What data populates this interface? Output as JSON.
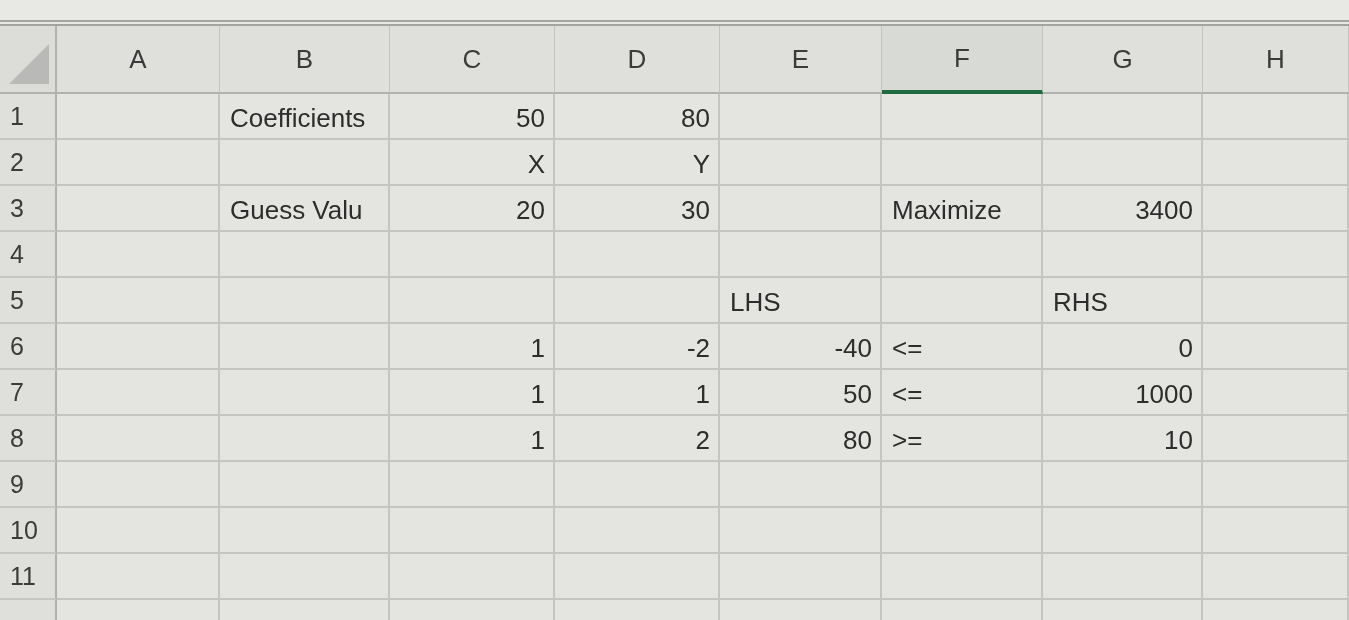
{
  "columns": [
    {
      "label": "A",
      "selected": false
    },
    {
      "label": "B",
      "selected": false
    },
    {
      "label": "C",
      "selected": false
    },
    {
      "label": "D",
      "selected": false
    },
    {
      "label": "E",
      "selected": false
    },
    {
      "label": "F",
      "selected": true
    },
    {
      "label": "G",
      "selected": false
    },
    {
      "label": "H",
      "selected": false
    }
  ],
  "rows": [
    {
      "label": "1",
      "cells": {
        "B": {
          "text": "Coefficients",
          "kind": "text"
        },
        "C": {
          "text": "50",
          "kind": "value"
        },
        "D": {
          "text": "80",
          "kind": "value"
        }
      }
    },
    {
      "label": "2",
      "cells": {
        "C": {
          "text": "X",
          "kind": "value"
        },
        "D": {
          "text": "Y",
          "kind": "value"
        }
      }
    },
    {
      "label": "3",
      "cells": {
        "B": {
          "text": "Guess Valu",
          "kind": "text"
        },
        "C": {
          "text": "20",
          "kind": "value"
        },
        "D": {
          "text": "30",
          "kind": "value"
        },
        "F": {
          "text": "Maximize",
          "kind": "text"
        },
        "G": {
          "text": "3400",
          "kind": "value"
        }
      }
    },
    {
      "label": "4"
    },
    {
      "label": "5",
      "cells": {
        "E": {
          "text": "LHS",
          "kind": "text"
        },
        "G": {
          "text": "RHS",
          "kind": "text"
        }
      }
    },
    {
      "label": "6",
      "cells": {
        "C": {
          "text": "1",
          "kind": "value"
        },
        "D": {
          "text": "-2",
          "kind": "value"
        },
        "E": {
          "text": "-40",
          "kind": "value"
        },
        "F": {
          "text": "<=",
          "kind": "text"
        },
        "G": {
          "text": "0",
          "kind": "value"
        }
      }
    },
    {
      "label": "7",
      "cells": {
        "C": {
          "text": "1",
          "kind": "value"
        },
        "D": {
          "text": "1",
          "kind": "value"
        },
        "E": {
          "text": "50",
          "kind": "value"
        },
        "F": {
          "text": "<=",
          "kind": "text"
        },
        "G": {
          "text": "1000",
          "kind": "value"
        }
      }
    },
    {
      "label": "8",
      "cells": {
        "C": {
          "text": "1",
          "kind": "value"
        },
        "D": {
          "text": "2",
          "kind": "value"
        },
        "E": {
          "text": "80",
          "kind": "value"
        },
        "F": {
          "text": ">=",
          "kind": "text"
        },
        "G": {
          "text": "10",
          "kind": "value"
        }
      }
    },
    {
      "label": "9"
    },
    {
      "label": "10"
    },
    {
      "label": "11"
    }
  ]
}
